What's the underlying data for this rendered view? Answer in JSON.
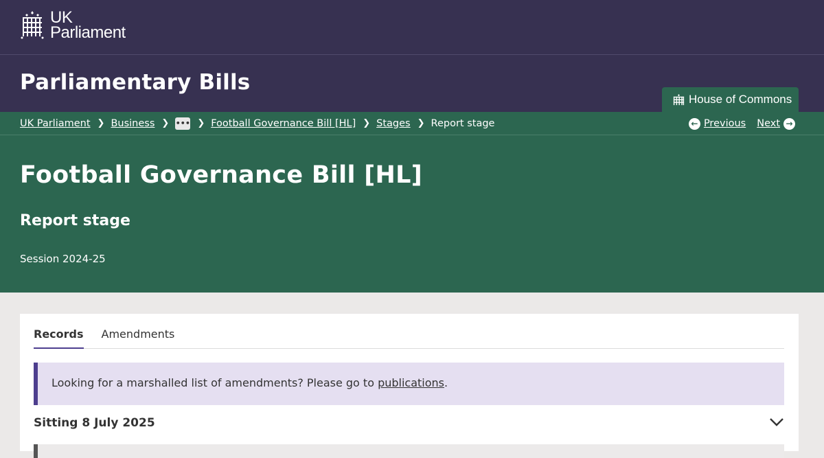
{
  "brand": {
    "line1": "UK",
    "line2": "Parliament"
  },
  "site": {
    "title": "Parliamentary Bills",
    "house_tab": "House of Commons"
  },
  "breadcrumb": {
    "items": [
      "UK Parliament",
      "Business",
      "Football Governance Bill [HL]",
      "Stages"
    ],
    "ellipsis": "•••",
    "current": "Report stage",
    "previous": "Previous",
    "next": "Next"
  },
  "bill": {
    "title": "Football Governance Bill [HL]",
    "stage": "Report stage",
    "session": "Session 2024-25"
  },
  "tabs": [
    {
      "label": "Records"
    },
    {
      "label": "Amendments"
    }
  ],
  "notice": {
    "text": "Looking for a marshalled list of amendments? Please go to ",
    "link": "publications",
    "end": "."
  },
  "sitting": {
    "title": "Sitting 8 July 2025"
  },
  "colors": {
    "purple": "#373151",
    "green": "#2c6650",
    "accent": "#4d3e8e",
    "notice_bg": "#e5dff1"
  }
}
